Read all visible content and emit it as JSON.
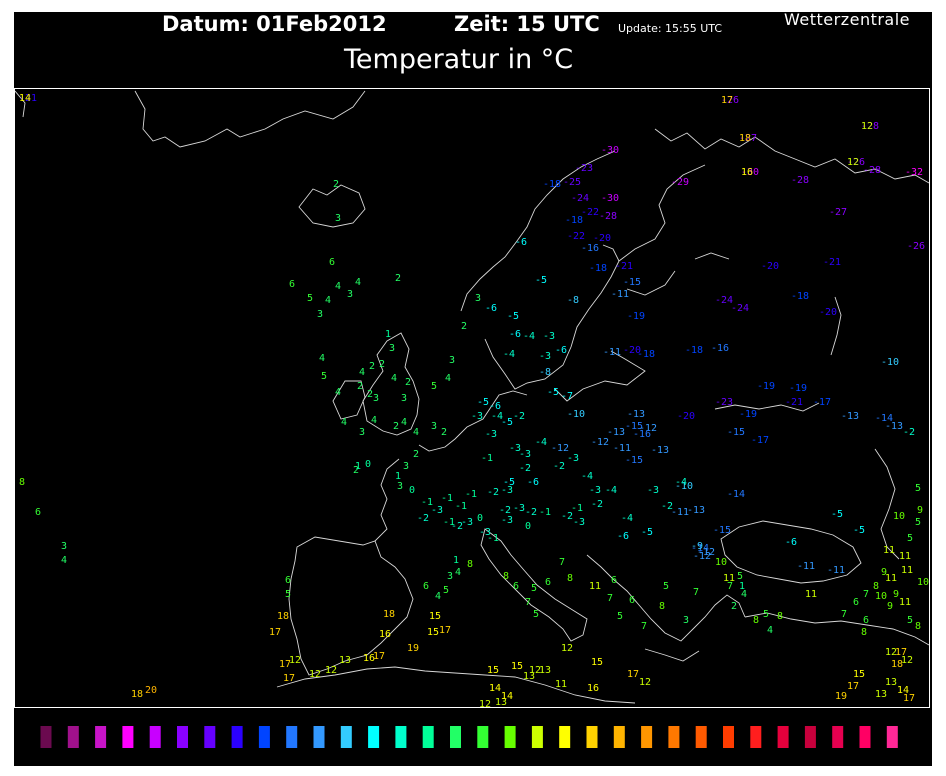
{
  "header": {
    "date": "Datum: 01Feb2012",
    "time": "Zeit: 15 UTC",
    "update": "Update: 15:55 UTC",
    "brand": "Wetterzentrale",
    "title": "Temperatur in °C"
  },
  "legend": {
    "values": [
      "-42",
      "-39",
      "-36",
      "-33",
      "-30",
      "-27",
      "-24",
      "-21",
      "-18",
      "-15",
      "-12",
      "-9",
      "-6",
      "-3",
      "0",
      "3",
      "6",
      "9",
      "12",
      "15",
      "18",
      "21",
      "24",
      "27",
      "30",
      "33",
      "36",
      "39",
      "42",
      "45",
      "48",
      "51"
    ],
    "colors": [
      "#6b0a4f",
      "#a0118c",
      "#c814c8",
      "#ff00ff",
      "#c800ff",
      "#8a00ff",
      "#6600ff",
      "#2b00ff",
      "#0044ff",
      "#2277ff",
      "#3399ff",
      "#33ccff",
      "#00ffff",
      "#00ffcc",
      "#00ff99",
      "#22ff66",
      "#33ff33",
      "#66ff00",
      "#ccff00",
      "#ffff00",
      "#ffd200",
      "#ffb400",
      "#ff9600",
      "#ff7800",
      "#ff5a00",
      "#ff3c00",
      "#ff1e1e",
      "#e6003c",
      "#c8003c",
      "#e60050",
      "#ff0064",
      "#ff2896"
    ]
  },
  "stations": [
    {
      "t": "-21"
    },
    {
      "t": "-26"
    },
    {
      "t": "-27"
    },
    {
      "t": "-28"
    },
    {
      "t": "-30"
    },
    {
      "t": "-26"
    },
    {
      "t": "-28"
    },
    {
      "t": "-28"
    },
    {
      "t": "-32"
    },
    {
      "t": "-27"
    },
    {
      "t": "-29"
    },
    {
      "t": "-30"
    },
    {
      "t": "-25"
    },
    {
      "t": "-23"
    },
    {
      "t": "-24"
    },
    {
      "t": "-30"
    },
    {
      "t": "-28"
    },
    {
      "t": "-22"
    },
    {
      "t": "-18"
    },
    {
      "t": "-18"
    },
    {
      "t": "-16"
    },
    {
      "t": "-20"
    },
    {
      "t": "-22"
    },
    {
      "t": "-18"
    },
    {
      "t": "-21"
    },
    {
      "t": "-20"
    },
    {
      "t": "-26"
    },
    {
      "t": "-24"
    },
    {
      "t": "-24"
    },
    {
      "t": "-18"
    },
    {
      "t": "-20"
    },
    {
      "t": "-15"
    },
    {
      "t": "-21"
    },
    {
      "t": "-19"
    },
    {
      "t": "-18"
    },
    {
      "t": "-23"
    },
    {
      "t": "-19"
    },
    {
      "t": "-19"
    },
    {
      "t": "-21"
    },
    {
      "t": "-17"
    },
    {
      "t": "-20"
    },
    {
      "t": "-19"
    },
    {
      "t": "-13"
    },
    {
      "t": "-13"
    },
    {
      "t": "-14"
    },
    {
      "t": "-10"
    },
    {
      "t": "-11"
    },
    {
      "t": "-11"
    },
    {
      "t": "-20"
    },
    {
      "t": "-18"
    },
    {
      "t": "-16"
    },
    {
      "t": "-15"
    },
    {
      "t": "-17"
    },
    {
      "t": "-15"
    },
    {
      "t": "-12"
    },
    {
      "t": "-13"
    },
    {
      "t": "-10"
    },
    {
      "t": "-14"
    },
    {
      "t": "-15"
    },
    {
      "t": "-13"
    },
    {
      "t": "-16"
    },
    {
      "t": "-10"
    },
    {
      "t": "-11"
    },
    {
      "t": "-12"
    },
    {
      "t": "-13"
    },
    {
      "t": "-15"
    },
    {
      "t": "-12"
    },
    {
      "t": "-11"
    },
    {
      "t": "-13"
    },
    {
      "t": "-14"
    },
    {
      "t": "-12"
    },
    {
      "t": "-11"
    },
    {
      "t": "-11"
    },
    {
      "t": "-9"
    },
    {
      "t": "-12"
    },
    {
      "t": "-6"
    },
    {
      "t": "-5"
    },
    {
      "t": "-6"
    },
    {
      "t": "-8"
    },
    {
      "t": "-5"
    },
    {
      "t": "-4"
    },
    {
      "t": "-3"
    },
    {
      "t": "-6"
    },
    {
      "t": "-8"
    },
    {
      "t": "-5"
    },
    {
      "t": "-7"
    },
    {
      "t": "-6"
    },
    {
      "t": "-4"
    },
    {
      "t": "-3"
    },
    {
      "t": "-5"
    },
    {
      "t": "-6"
    },
    {
      "t": "-4"
    },
    {
      "t": "-5"
    },
    {
      "t": "-3"
    },
    {
      "t": "-3"
    },
    {
      "t": "-3"
    },
    {
      "t": "-4"
    },
    {
      "t": "-5"
    },
    {
      "t": "-6"
    },
    {
      "t": "-2"
    },
    {
      "t": "-3"
    },
    {
      "t": "-1"
    },
    {
      "t": "-2"
    },
    {
      "t": "-3"
    },
    {
      "t": "-2"
    },
    {
      "t": "-3"
    },
    {
      "t": "-4"
    },
    {
      "t": "-3"
    },
    {
      "t": "-6"
    },
    {
      "t": "-4"
    },
    {
      "t": "-5"
    },
    {
      "t": "-2"
    },
    {
      "t": "-6"
    },
    {
      "t": "-5"
    },
    {
      "t": "-5"
    },
    {
      "t": "-4"
    },
    {
      "t": "-3"
    },
    {
      "t": "-2"
    },
    {
      "t": "-4"
    },
    {
      "t": "0"
    },
    {
      "t": "-1"
    },
    {
      "t": "-3"
    },
    {
      "t": "-2"
    },
    {
      "t": "-1"
    },
    {
      "t": "-1"
    },
    {
      "t": "-3"
    },
    {
      "t": "0"
    },
    {
      "t": "-2"
    },
    {
      "t": "-3"
    },
    {
      "t": "-2"
    },
    {
      "t": "-1"
    },
    {
      "t": "-3"
    },
    {
      "t": "-1"
    },
    {
      "t": "-1"
    },
    {
      "t": "-2"
    },
    {
      "t": "-1"
    },
    {
      "t": "-2"
    },
    {
      "t": "-3"
    },
    {
      "t": "-2"
    },
    {
      "t": "-3"
    },
    {
      "t": "-1"
    },
    {
      "t": "0"
    },
    {
      "t": "-2"
    },
    {
      "t": "2"
    },
    {
      "t": "2"
    },
    {
      "t": "3"
    },
    {
      "t": "1"
    },
    {
      "t": "2"
    },
    {
      "t": "4"
    },
    {
      "t": "3"
    },
    {
      "t": "4"
    },
    {
      "t": "2"
    },
    {
      "t": "3"
    },
    {
      "t": "4"
    },
    {
      "t": "4"
    },
    {
      "t": "3"
    },
    {
      "t": "2"
    },
    {
      "t": "4"
    },
    {
      "t": "2"
    },
    {
      "t": "3"
    },
    {
      "t": "1"
    },
    {
      "t": "2"
    },
    {
      "t": "4"
    },
    {
      "t": "2"
    },
    {
      "t": "3"
    },
    {
      "t": "5"
    },
    {
      "t": "4"
    },
    {
      "t": "2"
    },
    {
      "t": "3"
    },
    {
      "t": "3"
    },
    {
      "t": "4"
    },
    {
      "t": "5"
    },
    {
      "t": "6"
    },
    {
      "t": "6"
    },
    {
      "t": "4"
    },
    {
      "t": "3"
    },
    {
      "t": "4"
    },
    {
      "t": "2"
    },
    {
      "t": "3"
    },
    {
      "t": "2"
    },
    {
      "t": "4"
    },
    {
      "t": "5"
    },
    {
      "t": "4"
    },
    {
      "t": "3"
    },
    {
      "t": "2"
    },
    {
      "t": "1"
    },
    {
      "t": "0"
    },
    {
      "t": "3"
    },
    {
      "t": "6"
    },
    {
      "t": "4"
    },
    {
      "t": "5"
    },
    {
      "t": "3"
    },
    {
      "t": "1"
    },
    {
      "t": "4"
    },
    {
      "t": "8"
    },
    {
      "t": "8"
    },
    {
      "t": "6"
    },
    {
      "t": "7"
    },
    {
      "t": "5"
    },
    {
      "t": "6"
    },
    {
      "t": "5"
    },
    {
      "t": "7"
    },
    {
      "t": "8"
    },
    {
      "t": "11"
    },
    {
      "t": "6"
    },
    {
      "t": "7"
    },
    {
      "t": "5"
    },
    {
      "t": "6"
    },
    {
      "t": "7"
    },
    {
      "t": "8"
    },
    {
      "t": "5"
    },
    {
      "t": "3"
    },
    {
      "t": "7"
    },
    {
      "t": "10"
    },
    {
      "t": "11"
    },
    {
      "t": "7"
    },
    {
      "t": "5"
    },
    {
      "t": "1"
    },
    {
      "t": "4"
    },
    {
      "t": "2"
    },
    {
      "t": "8"
    },
    {
      "t": "5"
    },
    {
      "t": "4"
    },
    {
      "t": "8"
    },
    {
      "t": "11"
    },
    {
      "t": "7"
    },
    {
      "t": "6"
    },
    {
      "t": "7"
    },
    {
      "t": "8"
    },
    {
      "t": "9"
    },
    {
      "t": "11"
    },
    {
      "t": "5"
    },
    {
      "t": "8"
    },
    {
      "t": "10"
    },
    {
      "t": "11"
    },
    {
      "t": "9"
    },
    {
      "t": "11"
    },
    {
      "t": "10"
    },
    {
      "t": "5"
    },
    {
      "t": "9"
    },
    {
      "t": "5"
    },
    {
      "t": "8"
    },
    {
      "t": "6"
    },
    {
      "t": "10"
    },
    {
      "t": "11"
    },
    {
      "t": "9"
    },
    {
      "t": "11"
    },
    {
      "t": "5"
    },
    {
      "t": "8"
    },
    {
      "t": "6"
    },
    {
      "t": "3"
    },
    {
      "t": "4"
    },
    {
      "t": "6"
    },
    {
      "t": "5"
    },
    {
      "t": "18"
    },
    {
      "t": "17"
    },
    {
      "t": "17"
    },
    {
      "t": "17"
    },
    {
      "t": "12"
    },
    {
      "t": "12"
    },
    {
      "t": "12"
    },
    {
      "t": "13"
    },
    {
      "t": "16"
    },
    {
      "t": "17"
    },
    {
      "t": "16"
    },
    {
      "t": "19"
    },
    {
      "t": "15"
    },
    {
      "t": "15"
    },
    {
      "t": "17"
    },
    {
      "t": "18"
    },
    {
      "t": "15"
    },
    {
      "t": "14"
    },
    {
      "t": "12"
    },
    {
      "t": "13"
    },
    {
      "t": "14"
    },
    {
      "t": "12"
    },
    {
      "t": "15"
    },
    {
      "t": "16"
    },
    {
      "t": "18"
    },
    {
      "t": "20"
    },
    {
      "t": "19"
    },
    {
      "t": "17"
    },
    {
      "t": "15"
    },
    {
      "t": "13"
    },
    {
      "t": "18"
    },
    {
      "t": "17"
    },
    {
      "t": "12"
    },
    {
      "t": "15"
    },
    {
      "t": "13"
    },
    {
      "t": "12"
    },
    {
      "t": "13"
    },
    {
      "t": "11"
    },
    {
      "t": "17"
    },
    {
      "t": "12"
    },
    {
      "t": "13"
    },
    {
      "t": "14"
    },
    {
      "t": "17"
    },
    {
      "t": "12"
    },
    {
      "t": "14"
    },
    {
      "t": "17"
    },
    {
      "t": "18"
    },
    {
      "t": "12"
    },
    {
      "t": "16"
    },
    {
      "t": "12"
    }
  ]
}
